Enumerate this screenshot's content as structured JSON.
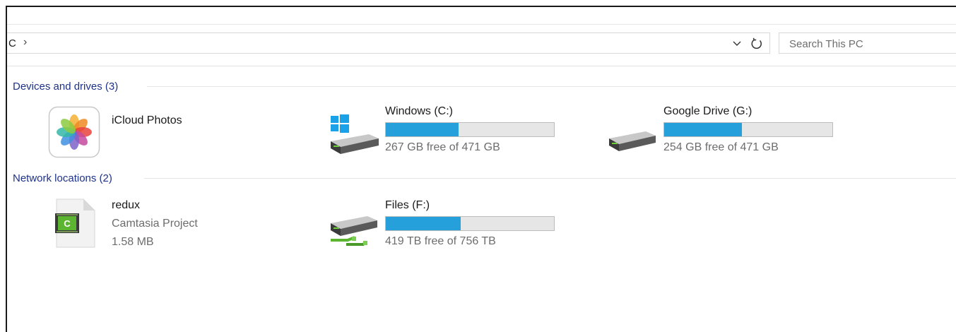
{
  "address": {
    "path_fragment": "C",
    "separator": "›",
    "dropdown_icon": "chevron-down-icon",
    "refresh_icon": "refresh-icon"
  },
  "search": {
    "placeholder": "Search This PC"
  },
  "groups": {
    "devices": {
      "title": "Devices and drives (3)",
      "items": [
        {
          "name": "iCloud Photos",
          "icon": "icloud-photos-icon"
        },
        {
          "name": "Windows (C:)",
          "icon": "windows-drive-icon",
          "free_text": "267 GB free of 471 GB",
          "used_fraction": 0.433
        },
        {
          "name": "Google Drive (G:)",
          "icon": "drive-icon",
          "free_text": "254 GB free of 471 GB",
          "used_fraction": 0.461
        }
      ]
    },
    "network": {
      "title": "Network locations (2)",
      "items": [
        {
          "name": "redux",
          "type": "Camtasia Project",
          "size": "1.58 MB",
          "icon": "camtasia-file-icon"
        },
        {
          "name": "Files (F:)",
          "icon": "network-drive-icon",
          "free_text": "419 TB free of 756 TB",
          "used_fraction": 0.446
        }
      ]
    }
  },
  "colors": {
    "group_title": "#1e3287",
    "bar_fill": "#26a0da",
    "bar_track": "#e6e6e6"
  }
}
